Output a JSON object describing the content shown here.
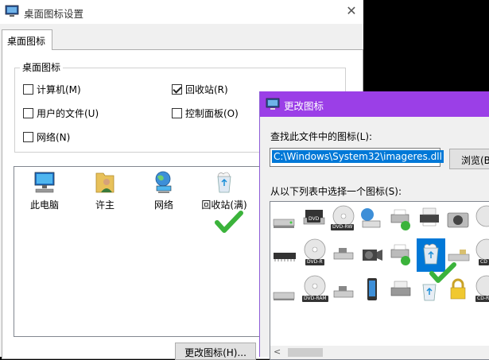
{
  "desktop_icon_settings": {
    "title": "桌面图标设置",
    "close": "✕",
    "tab_label": "桌面图标",
    "group_title": "桌面图标",
    "checkboxes": [
      {
        "label": "计算机(M)",
        "checked": false
      },
      {
        "label": "回收站(R)",
        "checked": true
      },
      {
        "label": "用户的文件(U)",
        "checked": false
      },
      {
        "label": "控制面板(O)",
        "checked": false
      },
      {
        "label": "网络(N)",
        "checked": false
      }
    ],
    "icons": [
      {
        "label": "此电脑",
        "icon": "computer-icon"
      },
      {
        "label": "许主",
        "icon": "user-folder-icon"
      },
      {
        "label": "网络",
        "icon": "network-icon"
      },
      {
        "label": "回收站(满)",
        "icon": "recycle-bin-full-icon"
      }
    ],
    "change_icon_button": "更改图标(H)..."
  },
  "change_icon_dialog": {
    "title": "更改图标",
    "find_label": "查找此文件中的图标(L):",
    "path_value": "C:\\Windows\\System32\\imageres.dll",
    "browse_button": "浏览(B)...",
    "select_label": "从以下列表中选择一个图标(S):",
    "disc_labels": {
      "dvd": "DVD",
      "dvdrw": "DVD-RW",
      "dvdr": "DVD-R",
      "cd": "CD",
      "dvdram": "DVD-RAM",
      "cdr": "CD-R"
    }
  },
  "colors": {
    "accent_purple": "#9b3fe7",
    "selection_blue": "#0078d7",
    "check_green": "#3bb33b"
  }
}
